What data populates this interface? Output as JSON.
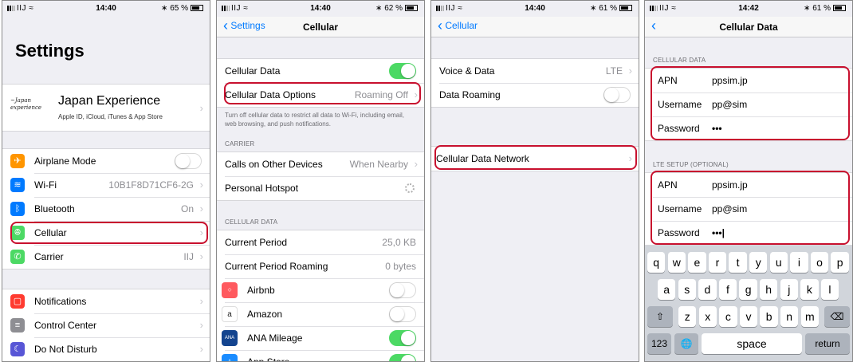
{
  "status": [
    {
      "carrier": "IIJ",
      "time": "14:40",
      "battery": "65 %"
    },
    {
      "carrier": "IIJ",
      "time": "14:40",
      "battery": "62 %"
    },
    {
      "carrier": "IIJ",
      "time": "14:40",
      "battery": "61 %"
    },
    {
      "carrier": "IIJ",
      "time": "14:42",
      "battery": "61 %"
    }
  ],
  "screen1": {
    "title": "Settings",
    "account_name": "Japan Experience",
    "account_sub": "Apple ID, iCloud, iTunes & App Store",
    "logo_text": "Japan Experience",
    "items": [
      {
        "label": "Airplane Mode",
        "value": "",
        "icon": "airplane-icon",
        "color": "#ff9500"
      },
      {
        "label": "Wi-Fi",
        "value": "10B1F8D71CF6-2G",
        "icon": "wifi-icon",
        "color": "#007aff"
      },
      {
        "label": "Bluetooth",
        "value": "On",
        "icon": "bluetooth-icon",
        "color": "#007aff"
      },
      {
        "label": "Cellular",
        "value": "",
        "icon": "cellular-icon",
        "color": "#4cd964"
      },
      {
        "label": "Carrier",
        "value": "IIJ",
        "icon": "phone-icon",
        "color": "#4cd964"
      }
    ],
    "items2": [
      {
        "label": "Notifications",
        "icon": "notifications-icon",
        "color": "#ff3b30"
      },
      {
        "label": "Control Center",
        "icon": "control-center-icon",
        "color": "#8e8e93"
      },
      {
        "label": "Do Not Disturb",
        "icon": "moon-icon",
        "color": "#5856d6"
      }
    ]
  },
  "screen2": {
    "back": "Settings",
    "title": "Cellular",
    "cellular_data": "Cellular Data",
    "options_label": "Cellular Data Options",
    "options_value": "Roaming Off",
    "footnote": "Turn off cellular data to restrict all data to Wi-Fi, including email, web browsing, and push notifications.",
    "carrier_header": "CARRIER",
    "calls_label": "Calls on Other Devices",
    "calls_value": "When Nearby",
    "hotspot_label": "Personal Hotspot",
    "data_header": "CELLULAR DATA",
    "period_label": "Current Period",
    "period_value": "25,0 KB",
    "roaming_label": "Current Period Roaming",
    "roaming_value": "0 bytes",
    "apps": [
      {
        "label": "Airbnb",
        "on": false,
        "icon": "airbnb-icon",
        "color": "#ff5a5f"
      },
      {
        "label": "Amazon",
        "on": false,
        "icon": "amazon-icon",
        "color": "#ffffff"
      },
      {
        "label": "ANA Mileage",
        "on": true,
        "icon": "ana-icon",
        "color": "#13448f"
      },
      {
        "label": "App Store",
        "on": true,
        "icon": "app-store-icon",
        "color": "#1a8cff"
      }
    ]
  },
  "screen3": {
    "back": "Cellular",
    "voice_label": "Voice & Data",
    "voice_value": "LTE",
    "roaming_label": "Data Roaming",
    "network_label": "Cellular Data Network"
  },
  "screen4": {
    "title": "Cellular Data",
    "section1": "CELLULAR DATA",
    "section2": "LTE SETUP (OPTIONAL)",
    "fields1": [
      {
        "label": "APN",
        "value": "ppsim.jp"
      },
      {
        "label": "Username",
        "value": "pp@sim"
      },
      {
        "label": "Password",
        "value": "•••"
      }
    ],
    "fields2": [
      {
        "label": "APN",
        "value": "ppsim.jp"
      },
      {
        "label": "Username",
        "value": "pp@sim"
      },
      {
        "label": "Password",
        "value": "•••|"
      }
    ],
    "keyboard": {
      "row1": [
        "q",
        "w",
        "e",
        "r",
        "t",
        "y",
        "u",
        "i",
        "o",
        "p"
      ],
      "row2": [
        "a",
        "s",
        "d",
        "f",
        "g",
        "h",
        "j",
        "k",
        "l"
      ],
      "row3": [
        "z",
        "x",
        "c",
        "v",
        "b",
        "n",
        "m"
      ],
      "shift": "⇧",
      "delete": "⌫",
      "numbers": "123",
      "globe": "🌐",
      "space": "space",
      "return": "return"
    }
  },
  "colors": {
    "accent": "#007aff",
    "switch_on": "#4cd964",
    "highlight": "#c8102e"
  }
}
